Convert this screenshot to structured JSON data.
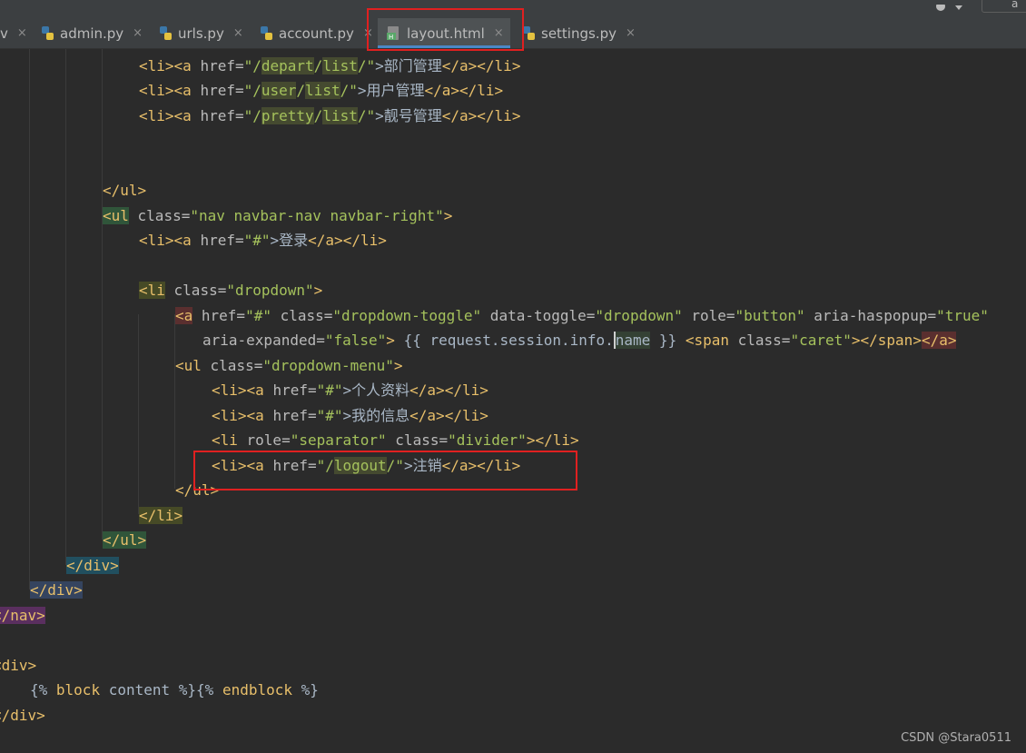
{
  "window": {
    "tabs": [
      {
        "label": "v",
        "active": false
      },
      {
        "label": "admin.py",
        "active": false
      },
      {
        "label": "urls.py",
        "active": false
      },
      {
        "label": "account.py",
        "active": false
      },
      {
        "label": "layout.html",
        "active": true
      },
      {
        "label": "settings.py",
        "active": false
      }
    ],
    "close_glyph": "×",
    "corner_text": "a"
  },
  "code": {
    "l1": [
      "<li>",
      "<a ",
      "href=",
      "\"/",
      "depart",
      "/",
      "list",
      "/\"",
      ">部门管理",
      "</a>",
      "</li>"
    ],
    "l2": [
      "<li>",
      "<a ",
      "href=",
      "\"/",
      "user",
      "/",
      "list",
      "/\"",
      ">用户管理",
      "</a>",
      "</li>"
    ],
    "l3": [
      "<li>",
      "<a ",
      "href=",
      "\"/",
      "pretty",
      "/",
      "list",
      "/\"",
      ">靓号管理",
      "</a>",
      "</li>"
    ],
    "l6": [
      "</ul>"
    ],
    "l7": [
      "<ul",
      " class=",
      "\"nav navbar-nav navbar-right\"",
      ">"
    ],
    "l8": [
      "<li>",
      "<a ",
      "href=",
      "\"#\"",
      ">登录",
      "</a>",
      "</li>"
    ],
    "l10": [
      "<li",
      " class=",
      "\"dropdown\"",
      ">"
    ],
    "l11": [
      "<a",
      " href=",
      "\"#\"",
      " class=",
      "\"dropdown-toggle\"",
      " data-toggle=",
      "\"dropdown\"",
      " role=",
      "\"button\"",
      " aria-haspopup=",
      "\"true\""
    ],
    "l12": [
      "aria-expanded=",
      "\"false\"",
      ">",
      " {{ request.session.info.",
      "name",
      " }} ",
      "<span",
      " class=",
      "\"caret\"",
      ">",
      "</span>",
      "</a>"
    ],
    "l13": [
      "<ul",
      " class=",
      "\"dropdown-menu\"",
      ">"
    ],
    "l14": [
      "<li>",
      "<a ",
      "href=",
      "\"#\"",
      ">个人资料",
      "</a>",
      "</li>"
    ],
    "l15": [
      "<li>",
      "<a ",
      "href=",
      "\"#\"",
      ">我的信息",
      "</a>",
      "</li>"
    ],
    "l16": [
      "<li ",
      "role=",
      "\"separator\"",
      " class=",
      "\"divider\"",
      ">",
      "</li>"
    ],
    "l17": [
      "<li>",
      "<a ",
      "href=",
      "\"/",
      "logout",
      "/\"",
      ">注销",
      "</a>",
      "</li>"
    ],
    "l18": [
      "</ul>"
    ],
    "l19": [
      "</li>"
    ],
    "l20": [
      "</ul>"
    ],
    "l21": [
      "</div>"
    ],
    "l22": [
      "</div>"
    ],
    "l23": [
      "</nav>"
    ],
    "l25": [
      "<div>"
    ],
    "l26": [
      "{% ",
      "block",
      " content %}{% ",
      "endblock",
      " %}"
    ],
    "l27": [
      "</div>"
    ]
  },
  "watermark": "CSDN @Stara0511",
  "colors": {
    "editor_bg": "#2b2b2b",
    "tag": "#e8bf6a",
    "attr": "#bababa",
    "string": "#a5c25c",
    "annotation_box": "#e02020",
    "active_tab_underline": "#4a88c7"
  }
}
